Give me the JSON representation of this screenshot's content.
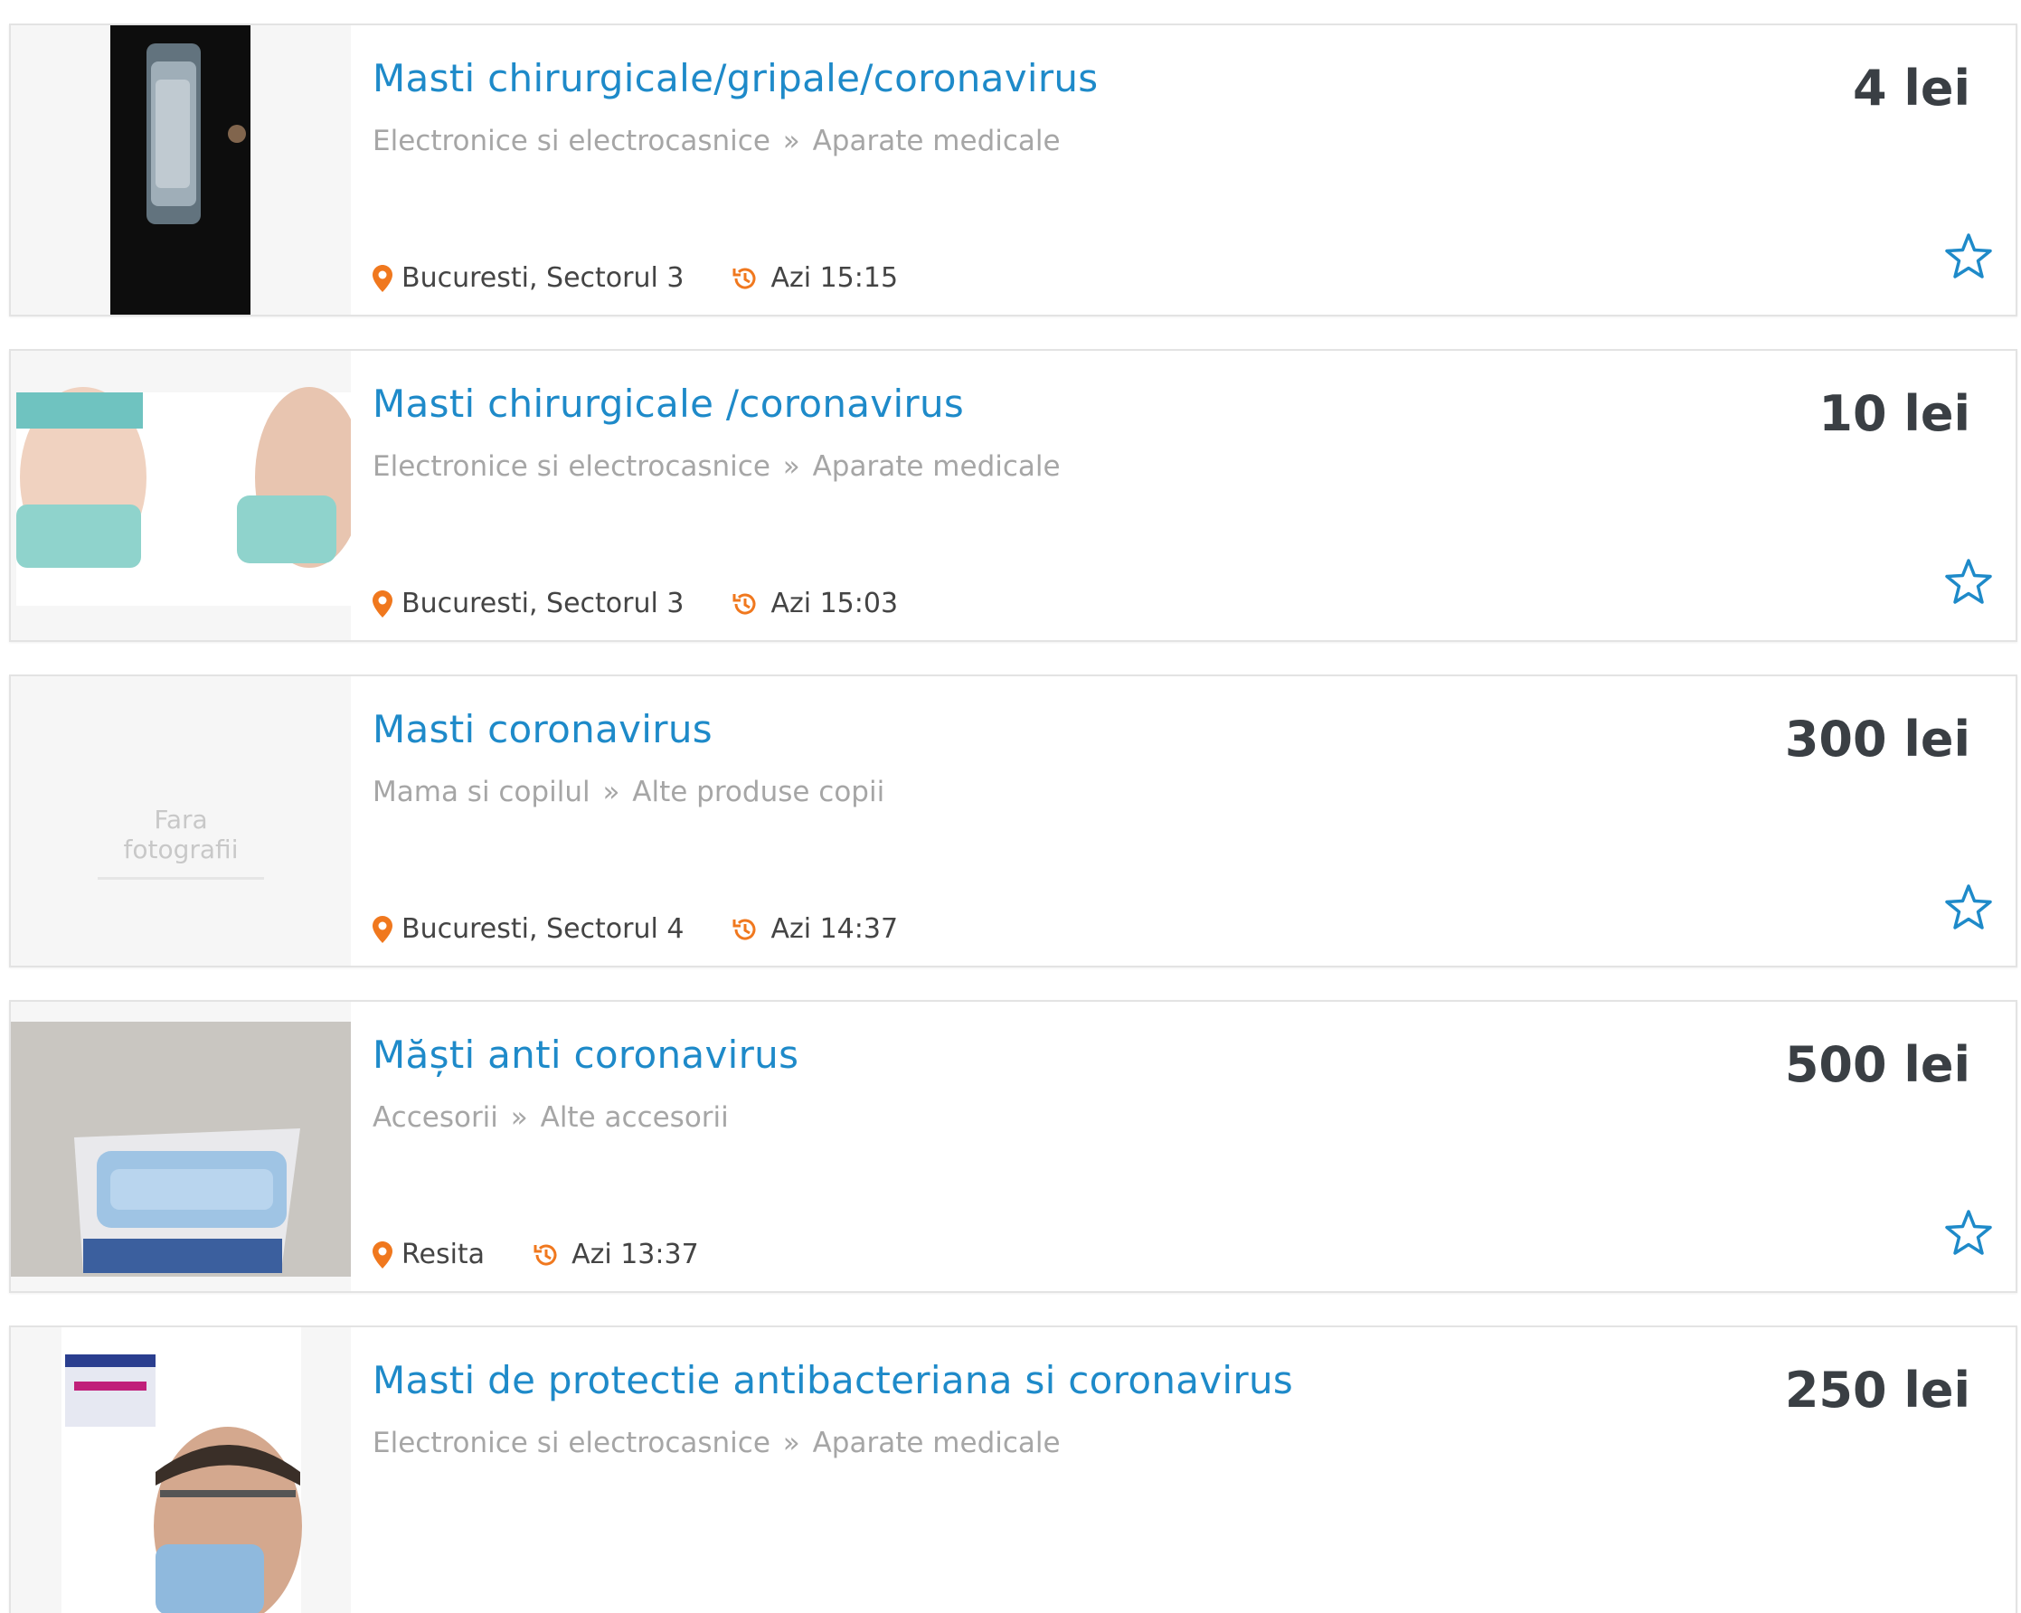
{
  "listings": [
    {
      "title": "Masti chirurgicale/gripale/coronavirus",
      "category": "Electronice si electrocasnice",
      "subcategory": "Aparate medicale",
      "price": "4 lei",
      "location": "Bucuresti, Sectorul 3",
      "time": "Azi 15:15",
      "image": "photo-plastic-bag-of-masks"
    },
    {
      "title": "Masti chirurgicale /coronavirus",
      "category": "Electronice si electrocasnice",
      "subcategory": "Aparate medicale",
      "price": "10 lei",
      "location": "Bucuresti, Sectorul 3",
      "time": "Azi 15:03",
      "image": "photo-people-wearing-masks"
    },
    {
      "title": "Masti coronavirus",
      "category": "Mama si copilul",
      "subcategory": "Alte produse copii",
      "price": "300 lei",
      "location": "Bucuresti, Sectorul 4",
      "time": "Azi 14:37",
      "image_placeholder": "Fara fotografii"
    },
    {
      "title": "Măști anti coronavirus",
      "category": "Accesorii",
      "subcategory": "Alte accesorii",
      "price": "500 lei",
      "location": "Resita",
      "time": "Azi 13:37",
      "image": "photo-box-of-masks"
    },
    {
      "title": "Masti de protectie antibacteriana si coronavirus",
      "category": "Electronice si electrocasnice",
      "subcategory": "Aparate medicale",
      "price": "250 lei",
      "image": "photo-man-wearing-mask"
    }
  ],
  "separator": "»",
  "colors": {
    "title": "#1e8ac9",
    "category": "#a6a6a6",
    "price": "#3a3f44",
    "meta_icon": "#f0781e",
    "favorite_star": "#1e8ac9"
  },
  "icons": {
    "location": "location-pin-icon",
    "time": "history-clock-icon",
    "favorite": "star-outline-icon"
  }
}
